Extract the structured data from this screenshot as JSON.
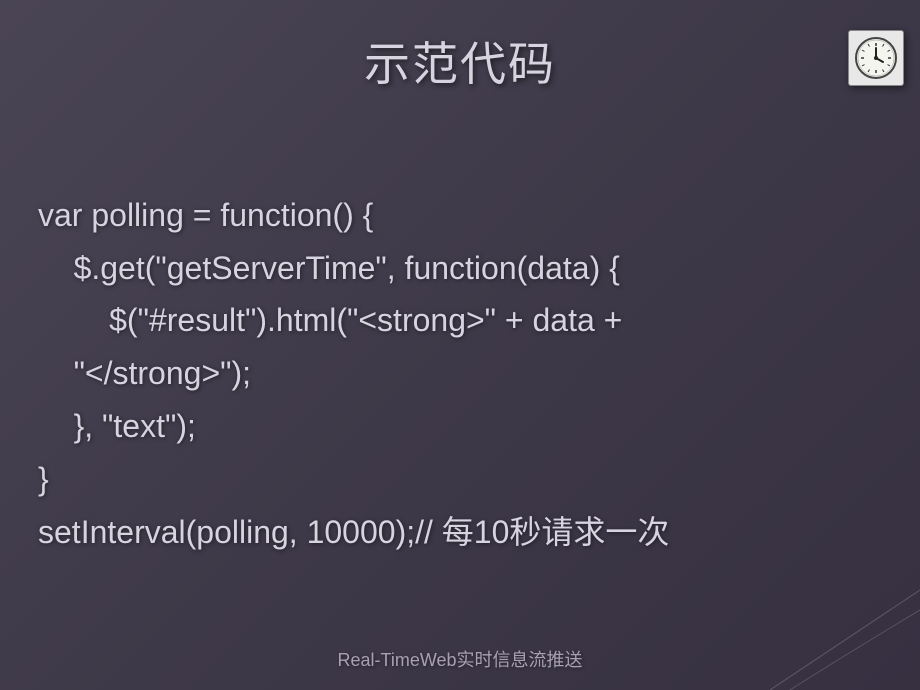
{
  "slide": {
    "title": "示范代码",
    "footer": "Real-TimeWeb实时信息流推送"
  },
  "code": {
    "line1": "var polling = function() {",
    "line2": "    $.get(\"getServerTime\", function(data) {",
    "line3": "        $(\"#result\").html(\"<strong>\" + data + ",
    "line4": "    \"</strong>\");",
    "line5": "    }, \"text\");",
    "line6": "}",
    "line7": "setInterval(polling, 10000);// 每10秒请求一次"
  },
  "icon": {
    "name": "clock-icon"
  }
}
